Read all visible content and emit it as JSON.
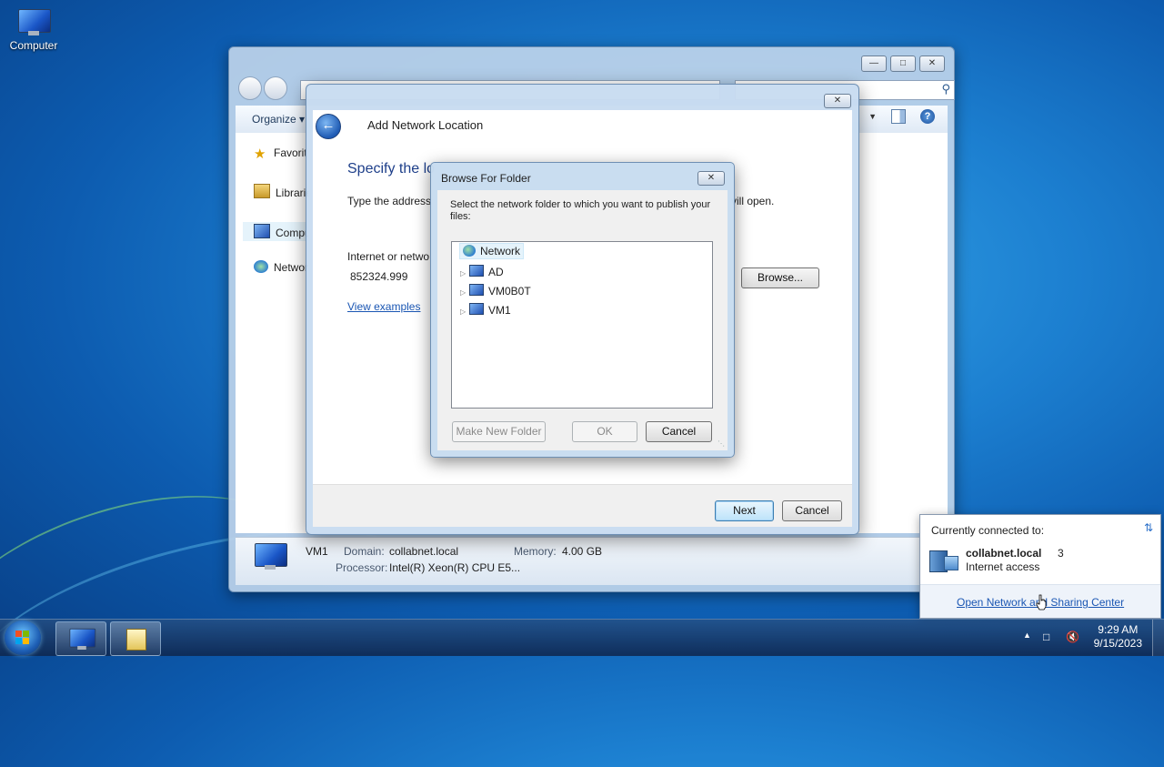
{
  "desktop": {
    "computer_label": "Computer"
  },
  "explorer": {
    "organize_label": "Organize",
    "nav": [
      "Favorit",
      "Librarie",
      "Compu",
      "Networ"
    ],
    "details": {
      "name": "VM1",
      "domain_label": "Domain:",
      "domain_value": "collabnet.local",
      "memory_label": "Memory:",
      "memory_value": "4.00 GB",
      "processor_label": "Processor:",
      "processor_value": "Intel(R) Xeon(R) CPU E5..."
    }
  },
  "wizard": {
    "title": "Add Network Location",
    "heading": "Specify the lo",
    "instruction": "Type the address",
    "instruction_tail": "vill open.",
    "field_label": "Internet or netwo",
    "field_value": "852324.999",
    "view_examples": "View examples",
    "browse_label": "Browse...",
    "next_label": "Next",
    "cancel_label": "Cancel"
  },
  "browse_dialog": {
    "title": "Browse For Folder",
    "instruction": "Select the network folder to which you want to publish your files:",
    "tree": {
      "root": "Network",
      "children": [
        "AD",
        "VM0B0T",
        "VM1"
      ]
    },
    "make_new_folder": "Make New Folder",
    "ok_label": "OK",
    "cancel_label": "Cancel"
  },
  "network_flyout": {
    "header": "Currently connected to:",
    "network_name": "collabnet.local",
    "network_number": "3",
    "status": "Internet access",
    "link": "Open Network and Sharing Center"
  },
  "taskbar": {
    "time": "9:29 AM",
    "date": "9/15/2023"
  }
}
